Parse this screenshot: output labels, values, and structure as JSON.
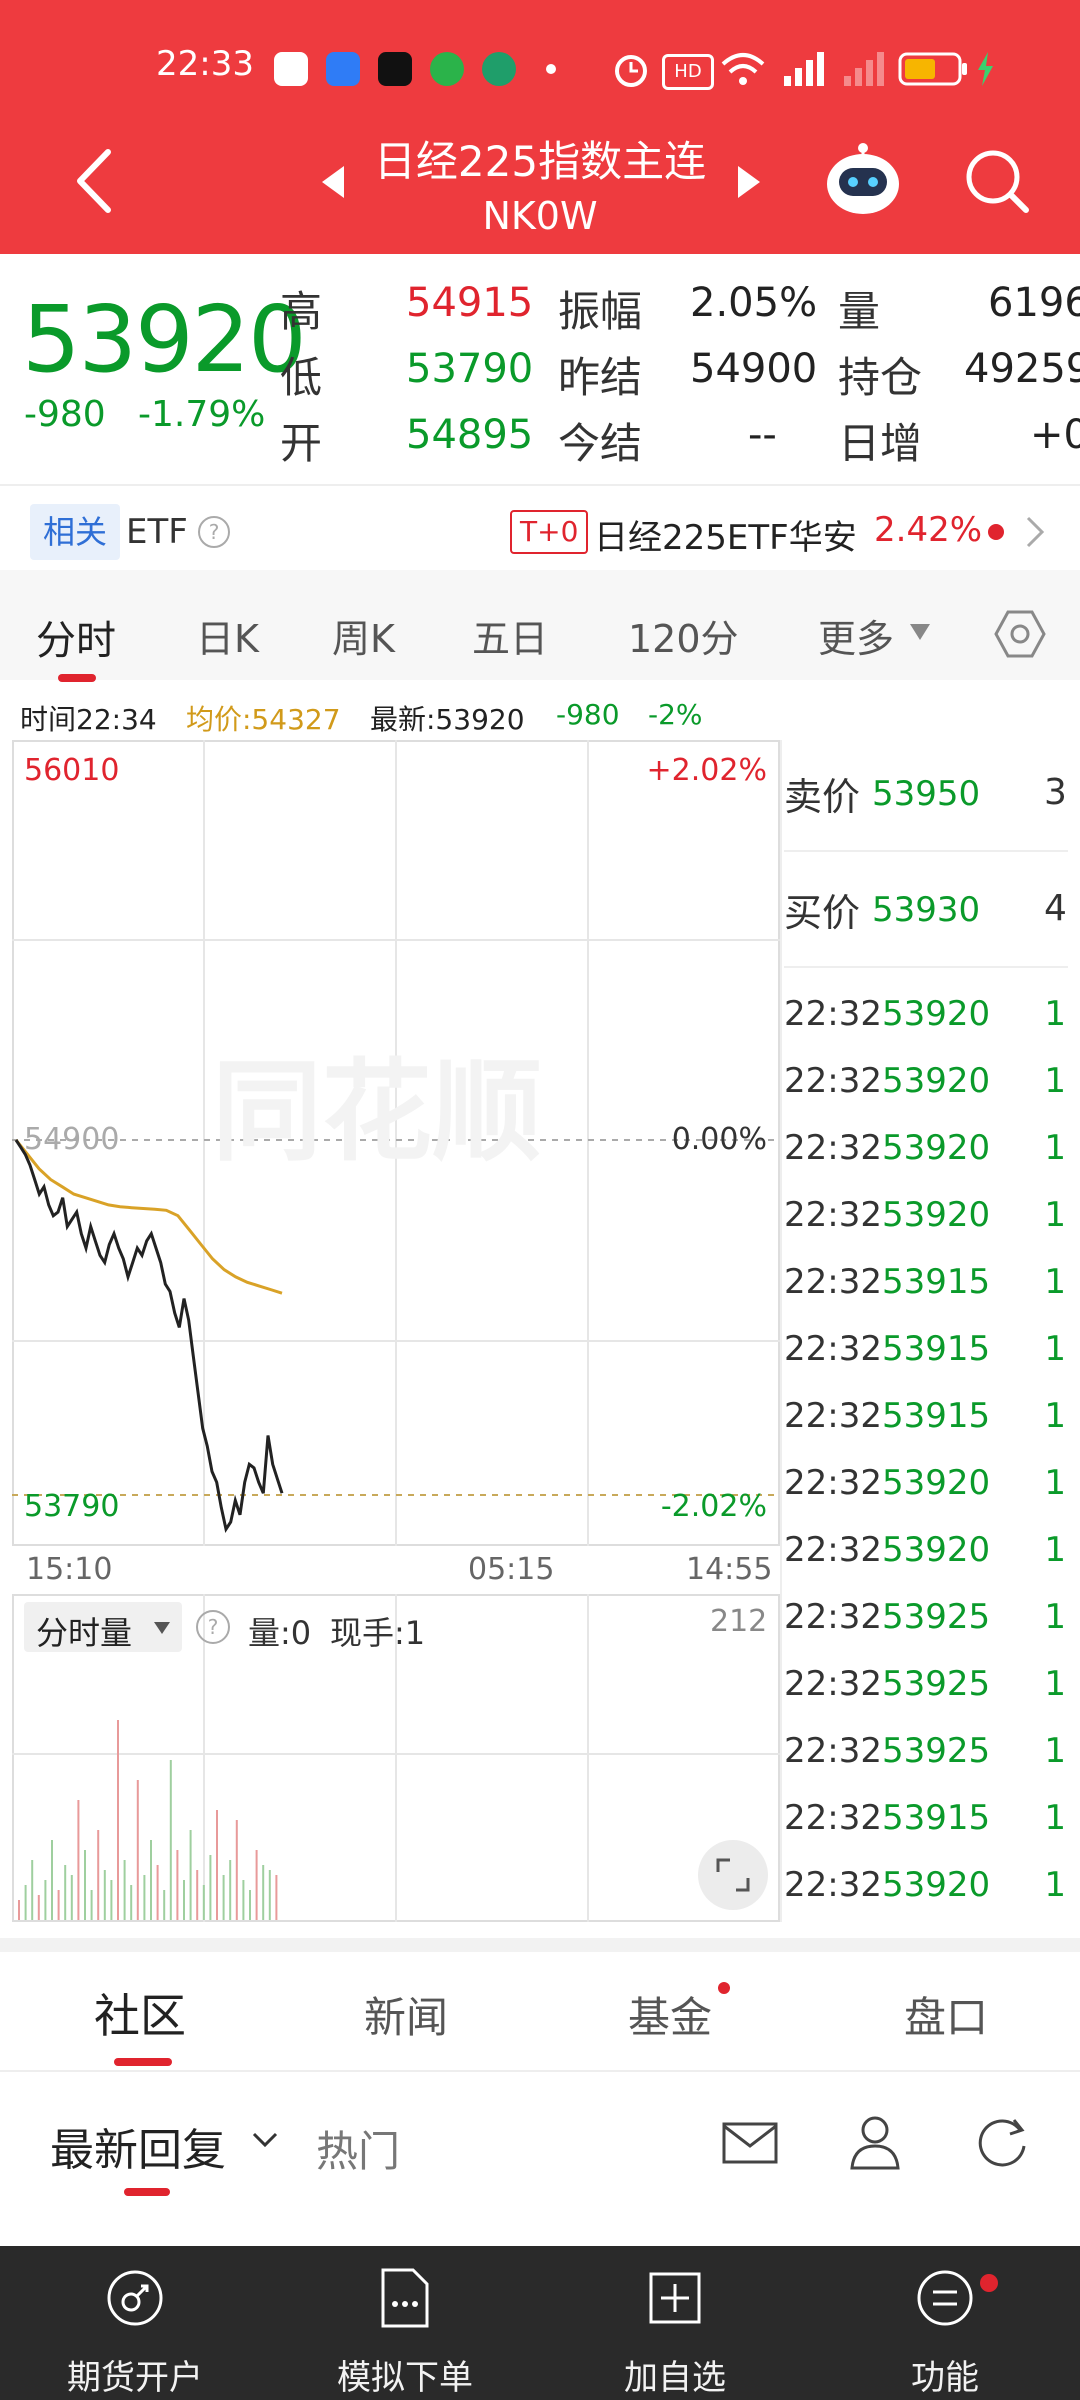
{
  "status_bar": {
    "time": "22:33"
  },
  "header": {
    "title": "日经225指数主连",
    "code": "NK0W"
  },
  "quote": {
    "price": "53920",
    "change": "-980",
    "change_pct": "-1.79%",
    "high_label": "高",
    "high": "54915",
    "low_label": "低",
    "low": "53790",
    "open_label": "开",
    "open": "54895",
    "amp_label": "振幅",
    "amp": "2.05%",
    "prev_settle_label": "昨结",
    "prev_settle": "54900",
    "today_settle_label": "今结",
    "today_settle": "--",
    "vol_label": "量",
    "vol": "6196",
    "oi_label": "持仓",
    "oi": "49259",
    "daily_inc_label": "日增",
    "daily_inc": "+0"
  },
  "etf": {
    "badge": "相关",
    "label": "ETF",
    "tag": "T+0",
    "name": "日经225ETF华安",
    "pct": "2.42%"
  },
  "tabs": [
    "分时",
    "日K",
    "周K",
    "五日",
    "120分",
    "更多"
  ],
  "info_line": {
    "time": "时间22:34",
    "avg": "均价:54327",
    "latest": "最新:53920",
    "chg": "-980",
    "pct": "-2%"
  },
  "chart_data": {
    "type": "line",
    "x_ticks": [
      "15:10",
      "05:15",
      "14:55"
    ],
    "y_high": "56010",
    "y_mid": "54900",
    "y_low": "53790",
    "pct_high": "+2.02%",
    "pct_mid": "0.00%",
    "pct_low": "-2.02%",
    "ylim": [
      53790,
      56010
    ],
    "price_series": [
      54900,
      54880,
      54860,
      54830,
      54790,
      54750,
      54770,
      54720,
      54690,
      54700,
      54740,
      54660,
      54680,
      54700,
      54640,
      54600,
      54660,
      54620,
      54580,
      54560,
      54610,
      54640,
      54600,
      54570,
      54520,
      54560,
      54600,
      54580,
      54620,
      54640,
      54600,
      54560,
      54500,
      54480,
      54420,
      54380,
      54460,
      54400,
      54300,
      54200,
      54100,
      54050,
      53980,
      53950,
      53880,
      53820,
      53840,
      53900,
      53860,
      53950,
      54000,
      53990,
      53950,
      53920,
      54080,
      54000,
      53960,
      53920
    ],
    "avg_series": [
      54900,
      54860,
      54820,
      54790,
      54770,
      54750,
      54740,
      54730,
      54720,
      54715,
      54712,
      54710,
      54708,
      54705,
      54690,
      54650,
      54610,
      54570,
      54540,
      54520,
      54505,
      54495,
      54485,
      54475
    ],
    "volume_label": "分时量",
    "volume_info": "量:0",
    "hand_info": "现手:1",
    "volume_max": "212"
  },
  "order_book": {
    "sell_label": "卖价",
    "sell_price": "53950",
    "sell_qty": "3",
    "buy_label": "买价",
    "buy_price": "53930",
    "buy_qty": "4"
  },
  "ticks": [
    {
      "t": "22:32",
      "p": "53920",
      "v": "1"
    },
    {
      "t": "22:32",
      "p": "53920",
      "v": "1"
    },
    {
      "t": "22:32",
      "p": "53920",
      "v": "1"
    },
    {
      "t": "22:32",
      "p": "53920",
      "v": "1"
    },
    {
      "t": "22:32",
      "p": "53915",
      "v": "1"
    },
    {
      "t": "22:32",
      "p": "53915",
      "v": "1"
    },
    {
      "t": "22:32",
      "p": "53915",
      "v": "1"
    },
    {
      "t": "22:32",
      "p": "53920",
      "v": "1"
    },
    {
      "t": "22:32",
      "p": "53920",
      "v": "1"
    },
    {
      "t": "22:32",
      "p": "53925",
      "v": "1"
    },
    {
      "t": "22:32",
      "p": "53925",
      "v": "1"
    },
    {
      "t": "22:32",
      "p": "53925",
      "v": "1"
    },
    {
      "t": "22:32",
      "p": "53915",
      "v": "1"
    },
    {
      "t": "22:32",
      "p": "53920",
      "v": "1"
    }
  ],
  "section_tabs": [
    "社区",
    "新闻",
    "基金",
    "盘口"
  ],
  "sub_tabs": {
    "latest": "最新回复",
    "hot": "热门"
  },
  "bottom_nav": [
    "期货开户",
    "模拟下单",
    "加自选",
    "功能"
  ],
  "watermark": "同花顺"
}
